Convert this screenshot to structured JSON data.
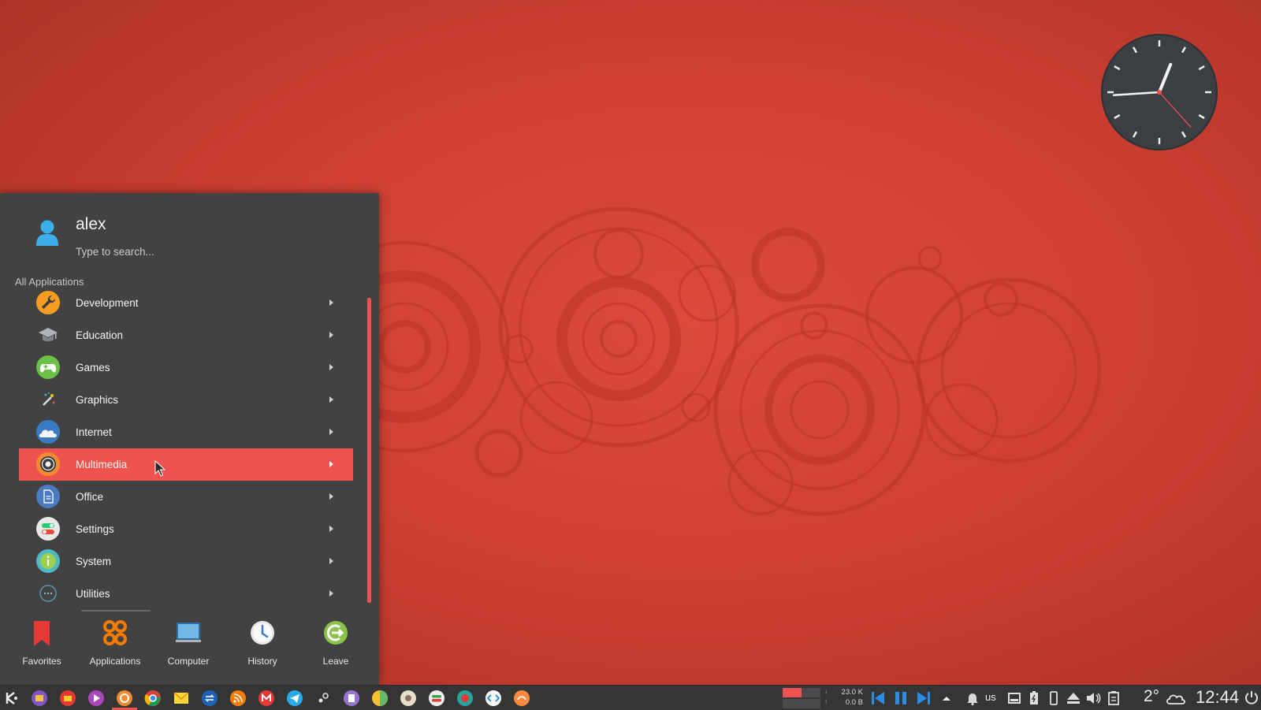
{
  "colors": {
    "accent": "#ef5350",
    "menu_bg": "#424242",
    "taskbar_bg": "#353535",
    "wallpaper": "#d34335"
  },
  "menu": {
    "username": "alex",
    "search_placeholder": "Type to search...",
    "section_title": "All Applications",
    "categories": [
      {
        "label": "Development",
        "icon": "wrench-icon"
      },
      {
        "label": "Education",
        "icon": "graduation-cap-icon"
      },
      {
        "label": "Games",
        "icon": "gamepad-icon"
      },
      {
        "label": "Graphics",
        "icon": "magic-wand-icon"
      },
      {
        "label": "Internet",
        "icon": "cloud-icon"
      },
      {
        "label": "Multimedia",
        "icon": "speaker-icon",
        "active": true
      },
      {
        "label": "Office",
        "icon": "document-icon"
      },
      {
        "label": "Settings",
        "icon": "toggle-icon"
      },
      {
        "label": "System",
        "icon": "info-icon"
      },
      {
        "label": "Utilities",
        "icon": "ellipsis-icon"
      }
    ],
    "bottom_tabs": [
      {
        "label": "Favorites",
        "icon": "bookmark-icon"
      },
      {
        "label": "Applications",
        "icon": "apps-grid-icon"
      },
      {
        "label": "Computer",
        "icon": "monitor-icon"
      },
      {
        "label": "History",
        "icon": "clock-icon"
      },
      {
        "label": "Leave",
        "icon": "logout-icon"
      }
    ]
  },
  "taskbar": {
    "network": {
      "down": "23.0 K",
      "up": "0.0 B"
    },
    "keyboard_layout": "us",
    "temperature": "2°",
    "time": "12:44"
  },
  "clock_widget": {
    "hour": 12,
    "minute": 44,
    "second": 23
  }
}
